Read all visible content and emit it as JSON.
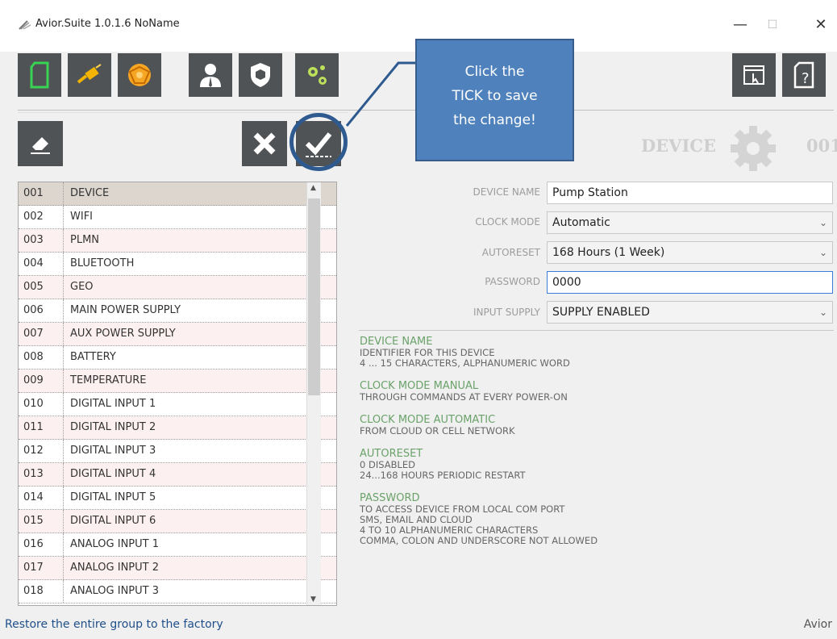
{
  "window": {
    "title": "Avior.Suite 1.0.1.6  NoName",
    "minimize": "—",
    "maximize": "☐",
    "close": "✕"
  },
  "callout": {
    "text_line1": "Click the",
    "text_line2": "TICK to save",
    "text_line3": "the change!"
  },
  "section": {
    "title": "DEVICE",
    "number": "001"
  },
  "list": {
    "items": [
      {
        "num": "001",
        "name": "DEVICE"
      },
      {
        "num": "002",
        "name": "WIFI"
      },
      {
        "num": "003",
        "name": "PLMN"
      },
      {
        "num": "004",
        "name": "BLUETOOTH"
      },
      {
        "num": "005",
        "name": "GEO"
      },
      {
        "num": "006",
        "name": "MAIN POWER SUPPLY"
      },
      {
        "num": "007",
        "name": "AUX POWER SUPPLY"
      },
      {
        "num": "008",
        "name": "BATTERY"
      },
      {
        "num": "009",
        "name": "TEMPERATURE"
      },
      {
        "num": "010",
        "name": "DIGITAL INPUT 1"
      },
      {
        "num": "011",
        "name": "DIGITAL INPUT 2"
      },
      {
        "num": "012",
        "name": "DIGITAL INPUT 3"
      },
      {
        "num": "013",
        "name": "DIGITAL INPUT 4"
      },
      {
        "num": "014",
        "name": "DIGITAL INPUT 5"
      },
      {
        "num": "015",
        "name": "DIGITAL INPUT 6"
      },
      {
        "num": "016",
        "name": "ANALOG INPUT 1"
      },
      {
        "num": "017",
        "name": "ANALOG INPUT 2"
      },
      {
        "num": "018",
        "name": "ANALOG INPUT 3"
      }
    ]
  },
  "form": {
    "device_name": {
      "label": "DEVICE NAME",
      "value": "Pump Station"
    },
    "clock_mode": {
      "label": "CLOCK MODE",
      "value": "Automatic"
    },
    "autoreset": {
      "label": "AUTORESET",
      "value": "168 Hours (1 Week)"
    },
    "password": {
      "label": "PASSWORD",
      "value": "0000"
    },
    "input_supply": {
      "label": "INPUT SUPPLY",
      "value": "SUPPLY ENABLED"
    }
  },
  "help": {
    "b1": {
      "h": "DEVICE NAME",
      "l1": "IDENTIFIER FOR THIS DEVICE",
      "l2": "4 ... 15 CHARACTERS, ALPHANUMERIC WORD"
    },
    "b2": {
      "h": "CLOCK MODE MANUAL",
      "l1": "THROUGH COMMANDS AT EVERY POWER-ON"
    },
    "b3": {
      "h": "CLOCK MODE AUTOMATIC",
      "l1": "FROM CLOUD OR CELL NETWORK"
    },
    "b4": {
      "h": "AUTORESET",
      "l1": "0 DISABLED",
      "l2": "24...168 HOURS PERIODIC RESTART"
    },
    "b5": {
      "h": "PASSWORD",
      "l1": "TO ACCESS DEVICE FROM LOCAL COM PORT",
      "l2": "SMS, EMAIL AND CLOUD",
      "l3": "4 TO 10 ALPHANUMERIC CHARACTERS",
      "l4": "COMMA, COLON AND UNDERSCORE NOT ALLOWED"
    }
  },
  "status": {
    "left": "Restore the entire group to the factory",
    "right": "Avior"
  },
  "colors": {
    "accent": "#4f81bd",
    "toolbar": "#505356",
    "help_heading": "#6aa26a"
  }
}
